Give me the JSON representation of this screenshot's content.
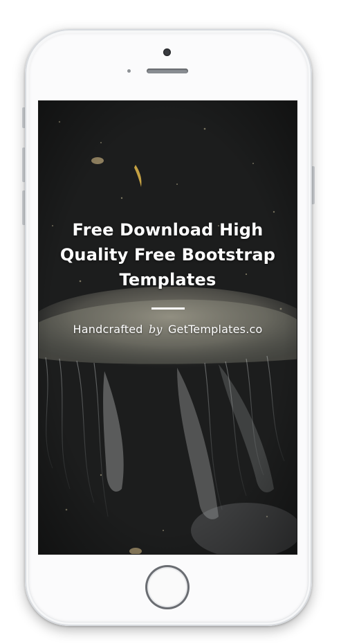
{
  "hero": {
    "title": "Free Download High Quality Free Bootstrap Templates",
    "subtitle_prefix": "Handcrafted",
    "subtitle_by": "by",
    "subtitle_brand": "GetTemplates.co"
  },
  "device": {
    "model": "phone-mockup",
    "frame_color": "#eceef0",
    "screen_bg": "#1b1c1c"
  },
  "background": {
    "subject": "jellyfish-photo",
    "accent_color": "#e2b84a"
  }
}
